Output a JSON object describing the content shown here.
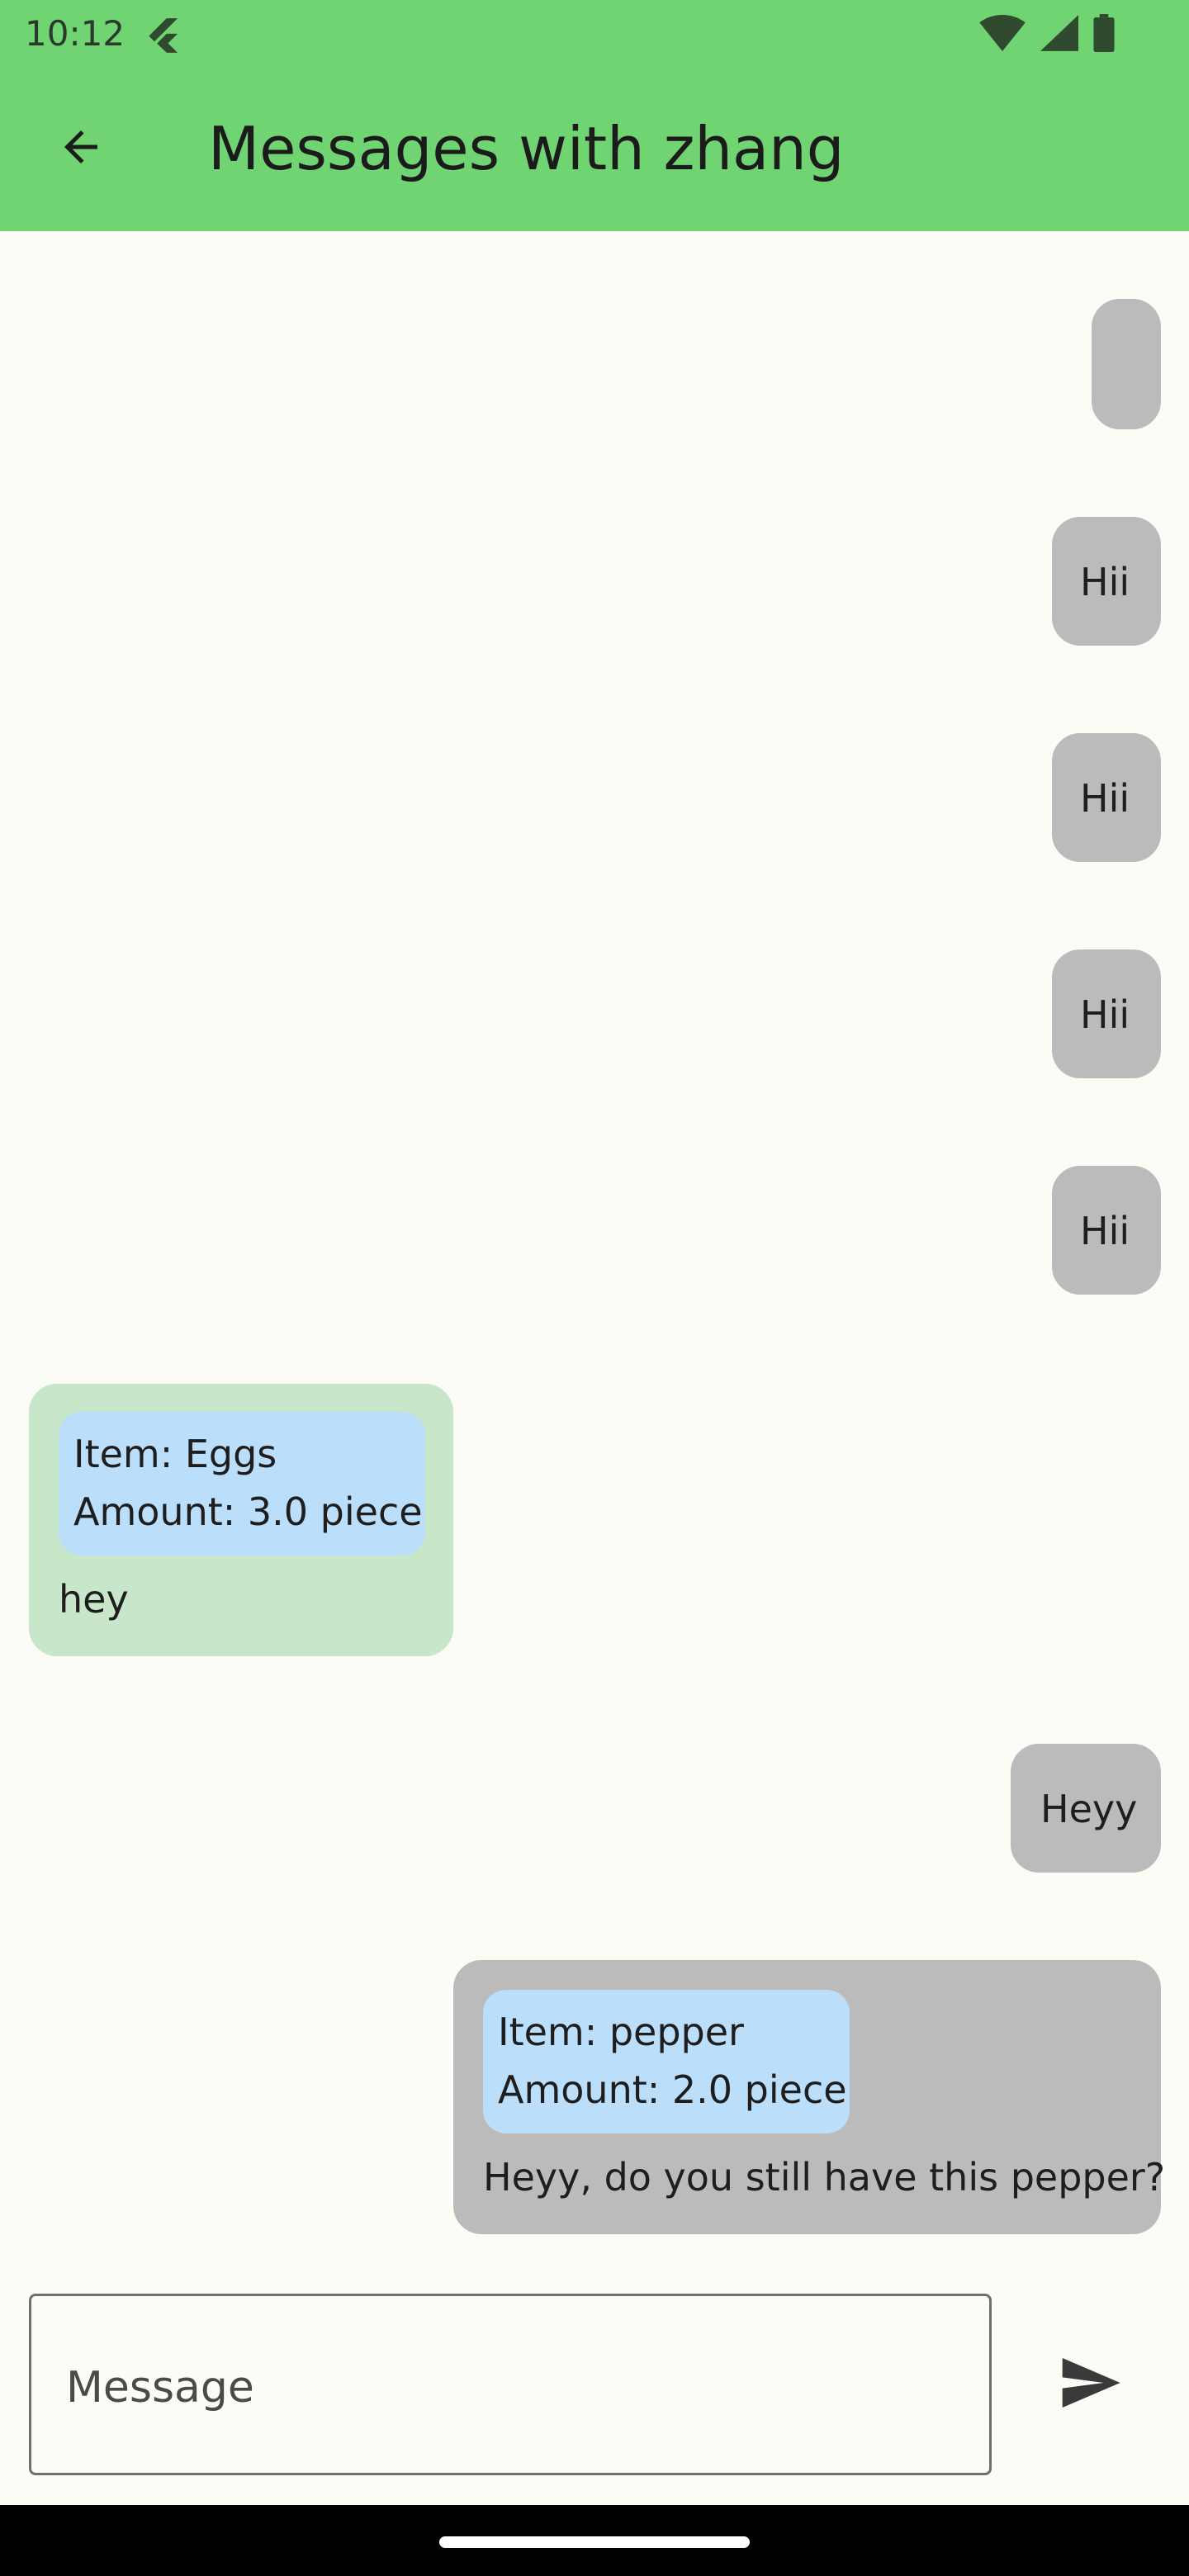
{
  "status_bar": {
    "time": "10:12",
    "icons": [
      "flutter-icon",
      "wifi-icon",
      "signal-icon",
      "battery-icon"
    ]
  },
  "header": {
    "title": "Messages with zhang",
    "back_icon": "arrow-back-icon",
    "background": "#70d472"
  },
  "messages": [
    {
      "side": "mine",
      "text": ""
    },
    {
      "side": "mine",
      "text": "Hii"
    },
    {
      "side": "mine",
      "text": "Hii"
    },
    {
      "side": "mine",
      "text": "Hii"
    },
    {
      "side": "mine",
      "text": "Hii"
    },
    {
      "side": "theirs",
      "item": {
        "line1": "Item: Eggs",
        "line2": "Amount: 3.0 piece"
      },
      "text": "hey"
    },
    {
      "side": "mine",
      "text": "Heyy"
    },
    {
      "side": "mine",
      "item": {
        "line1": "Item: pepper",
        "line2": "Amount: 2.0 piece"
      },
      "text": "Heyy, do you still have this pepper?"
    }
  ],
  "composer": {
    "placeholder": "Message",
    "value": "",
    "send_icon": "send-icon"
  },
  "colors": {
    "mine_bubble": "#bbbbbb",
    "theirs_bubble": "#c8e6c9",
    "item_card": "#bbdefb",
    "background": "#fcfcf7"
  }
}
